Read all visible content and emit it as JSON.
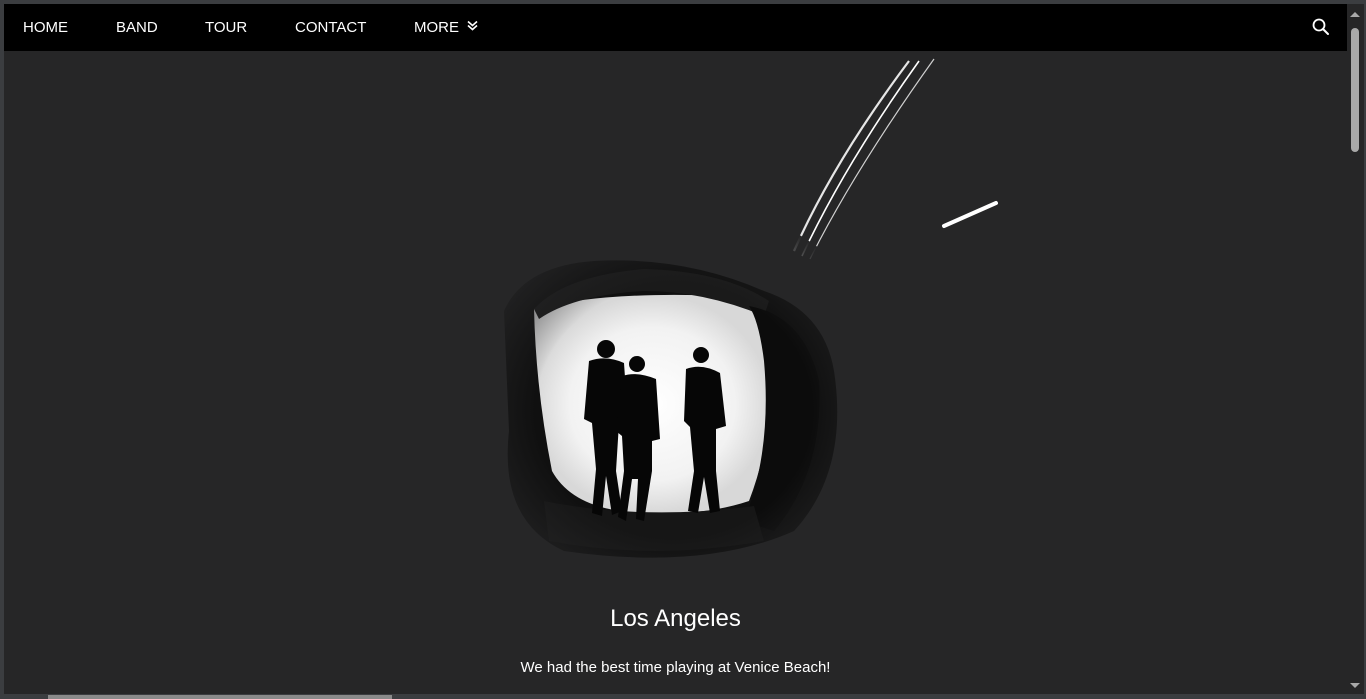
{
  "nav": {
    "items": [
      {
        "label": "HOME"
      },
      {
        "label": "BAND"
      },
      {
        "label": "TOUR"
      },
      {
        "label": "CONTACT"
      },
      {
        "label": "MORE"
      }
    ],
    "search_icon": "search-icon",
    "more_icon": "chevron-down-double-icon"
  },
  "hero": {
    "image": "band-silhouettes-in-tunnel-photo"
  },
  "content": {
    "title": "Los Angeles",
    "description": "We had the best time playing at Venice Beach!"
  },
  "colors": {
    "navbar_bg": "#000000",
    "page_bg": "#262627",
    "text": "#ffffff"
  }
}
